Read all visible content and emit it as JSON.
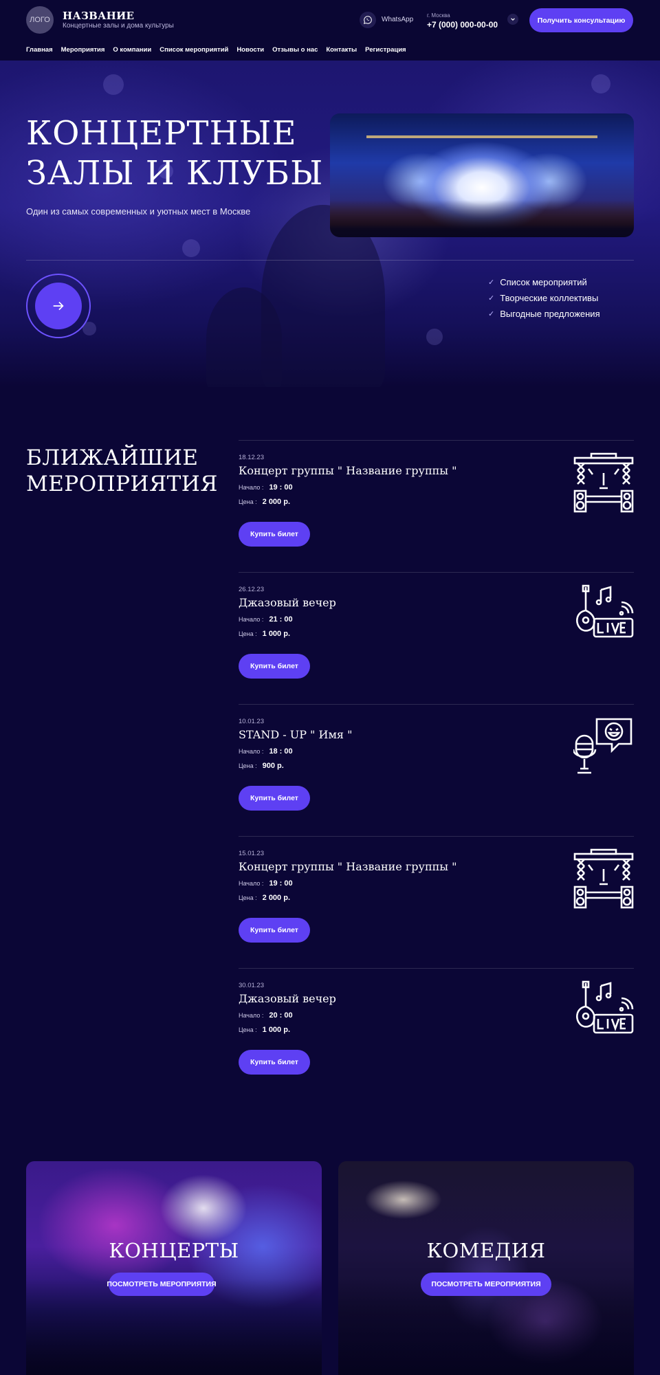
{
  "header": {
    "logo_text": "ЛОГО",
    "brand_title": "НАЗВАНИЕ",
    "brand_subtitle": "Концертные залы и дома культуры",
    "whatsapp_label": "WhatsApp",
    "city": "г. Москва",
    "phone": "+7 (000) 000-00-00",
    "consult_button": "Получить консультацию"
  },
  "nav": [
    {
      "label": "Главная"
    },
    {
      "label": "Мероприятия"
    },
    {
      "label": "О компании"
    },
    {
      "label": "Список мероприятий"
    },
    {
      "label": "Новости"
    },
    {
      "label": "Отзывы о нас"
    },
    {
      "label": "Контакты"
    },
    {
      "label": "Регистрация"
    }
  ],
  "hero": {
    "title_line1": "КОНЦЕРТНЫЕ",
    "title_line2": "ЗАЛЫ И КЛУБЫ",
    "subtitle": "Один из самых современных и уютных мест в Москве",
    "features": [
      {
        "label": "Список мероприятий"
      },
      {
        "label": "Творческие коллективы"
      },
      {
        "label": "Выгодные предложения"
      }
    ]
  },
  "events": {
    "title_line1": "БЛИЖАЙШИЕ",
    "title_line2": "МЕРОПРИЯТИЯ",
    "start_label": "Начало :",
    "price_label": "Цена :",
    "buy_label": "Купить билет",
    "items": [
      {
        "date": "18.12.23",
        "name": "Концерт группы \" Название группы \"",
        "start": "19 : 00",
        "price": "2 000 р.",
        "icon": "stage-icon"
      },
      {
        "date": "26.12.23",
        "name": "Джазовый вечер",
        "start": "21 : 00",
        "price": "1 000 р.",
        "icon": "guitar-live-icon"
      },
      {
        "date": "10.01.23",
        "name": "STAND - UP \" Имя \"",
        "start": "18 : 00",
        "price": "900 р.",
        "icon": "microphone-comedy-icon"
      },
      {
        "date": "15.01.23",
        "name": "Концерт группы \" Название группы \"",
        "start": "19 : 00",
        "price": "2 000 р.",
        "icon": "stage-icon"
      },
      {
        "date": "30.01.23",
        "name": "Джазовый вечер",
        "start": "20 : 00",
        "price": "1 000 р.",
        "icon": "guitar-live-icon"
      }
    ]
  },
  "categories": [
    {
      "title": "КОНЦЕРТЫ",
      "button": "ПОСМОТРЕТЬ МЕРОПРИЯТИЯ"
    },
    {
      "title": "КОМЕДИЯ",
      "button": "ПОСМОТРЕТЬ МЕРОПРИЯТИЯ"
    }
  ],
  "colors": {
    "background": "#0b0636",
    "accent": "#5e40f3",
    "header": "#0a0633"
  }
}
